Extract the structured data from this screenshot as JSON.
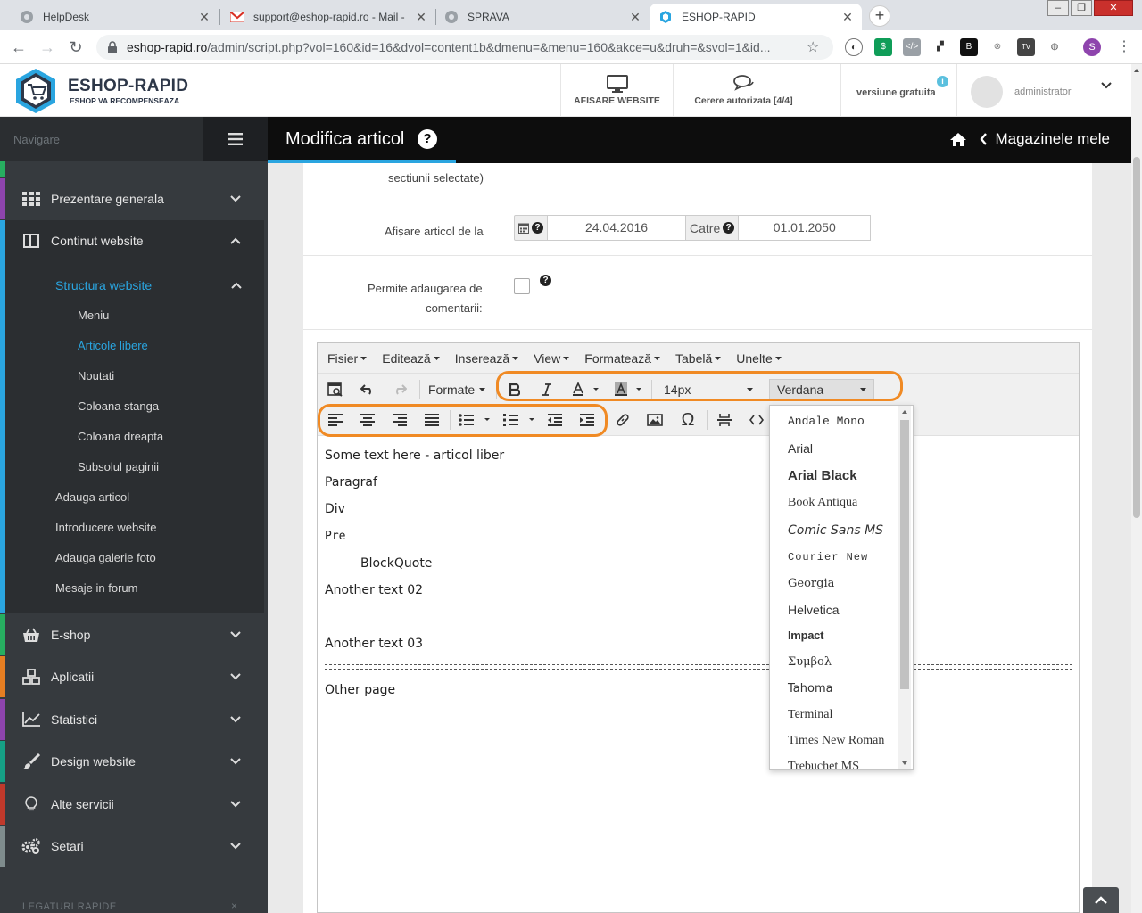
{
  "browser": {
    "tabs": [
      {
        "title": "HelpDesk",
        "icon": "chrome-icon"
      },
      {
        "title": "support@eshop-rapid.ro - Mail -",
        "icon": "gmail-icon"
      },
      {
        "title": "SPRAVA",
        "icon": "chrome-icon"
      },
      {
        "title": "ESHOP-RAPID",
        "icon": "eshop-favicon",
        "active": true
      }
    ],
    "url_host": "eshop-rapid.ro",
    "url_path": "/admin/script.php?vol=160&id=16&dvol=content1b&dmenu=&menu=160&akce=u&druh=&svol=1&id...",
    "profile_letter": "S",
    "ext_b": "B",
    "ext_tv": "TV"
  },
  "header": {
    "logo_title": "ESHOP-RAPID",
    "logo_subtitle": "ESHOP VA RECOMPENSEAZA",
    "view_website": "AFISARE WEBSITE",
    "auth_requests": "Cerere autorizata [4/4]",
    "version": "versiune gratuita",
    "version_info": "i",
    "user": "administrator"
  },
  "sidebar": {
    "nav_label": "Navigare",
    "items": [
      {
        "label": "Prezentare generala",
        "icon": "grid-icon",
        "color": "#8e44ad"
      },
      {
        "label": "Continut website",
        "icon": "layout-icon",
        "color": "#2aa5e0"
      }
    ],
    "sub_header": "Structura website",
    "subitems": [
      "Meniu",
      "Articole libere",
      "Noutati",
      "Coloana stanga",
      "Coloana dreapta",
      "Subsolul paginii"
    ],
    "sub2": [
      "Adauga articol",
      "Introducere website",
      "Adauga galerie foto",
      "Mesaje in forum"
    ],
    "items_bottom": [
      {
        "label": "E-shop",
        "icon": "basket-icon",
        "color": "#27ae60"
      },
      {
        "label": "Aplicatii",
        "icon": "cubes-icon",
        "color": "#e67e22"
      },
      {
        "label": "Statistici",
        "icon": "chart-icon",
        "color": "#8e44ad"
      },
      {
        "label": "Design website",
        "icon": "brush-icon",
        "color": "#16a085"
      },
      {
        "label": "Alte servicii",
        "icon": "bulb-icon",
        "color": "#c0392b"
      },
      {
        "label": "Setari",
        "icon": "gears-icon",
        "color": "#7f8c8d"
      }
    ],
    "quick_links": "LEGATURI RAPIDE",
    "quick_links_close": "×"
  },
  "title": {
    "text": "Modifica articol",
    "help": "?",
    "shops": "Magazinele mele"
  },
  "form": {
    "top_label": "sectiunii selectate)",
    "display_label": "Afișare articol de la",
    "date_from": "24.04.2016",
    "to_label": "Catre",
    "date_to": "01.01.2050",
    "comments_label_1": "Permite adaugarea de",
    "comments_label_2": "comentarii:",
    "help": "?"
  },
  "editor": {
    "menus": [
      "Fisier",
      "Editează",
      "Inserează",
      "View",
      "Formatează",
      "Tabelă",
      "Unelte"
    ],
    "formats_label": "Formate",
    "font_size": "14px",
    "font_family": "Verdana",
    "content": [
      "Some text here - articol liber",
      "Paragraf",
      "Div",
      "Pre",
      "BlockQuote",
      "Another text 02",
      "Another text 03",
      "Other page"
    ],
    "fonts": [
      "Andale Mono",
      "Arial",
      "Arial Black",
      "Book Antiqua",
      "Comic Sans MS",
      "Courier New",
      "Georgia",
      "Helvetica",
      "Impact",
      "Συμβολ",
      "Tahoma",
      "Terminal",
      "Times New Roman",
      "Trebuchet MS"
    ]
  },
  "colors": {
    "accent": "#2aa5e0",
    "highlight": "#f08a24",
    "sidebar_bg": "#363a3e",
    "title_bg": "#0d0d0d"
  }
}
